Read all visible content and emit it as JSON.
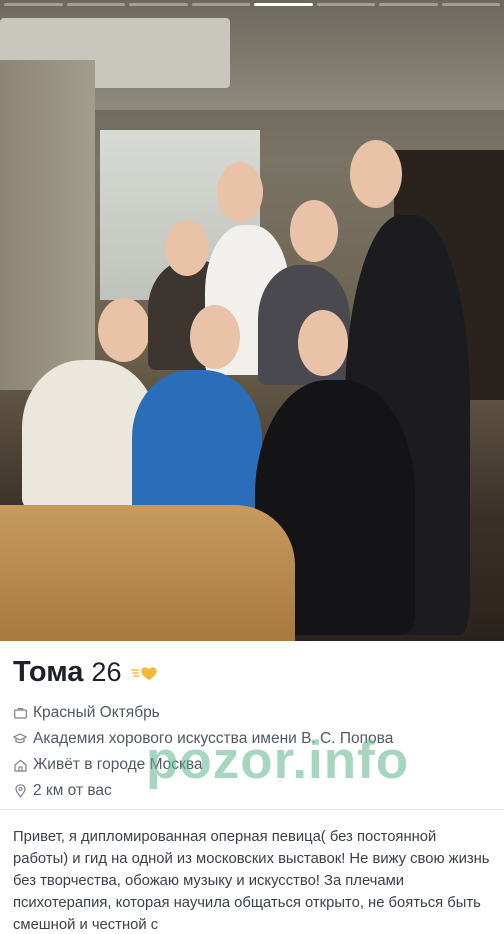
{
  "profile": {
    "name": "Тома",
    "age": "26",
    "work": "Красный Октябрь",
    "education": "Академия хорового искусства имени В. С. Попова",
    "city": "Живёт в городе Москва",
    "distance": "2 км от вас",
    "bio": "Привет, я дипломированная оперная певица( без постоянной работы) и гид на одной из московских выставок! Не вижу свою жизнь без творчества, обожаю музыку и искусство! За плечами психотерапия, которая научила общаться открыто, не бояться быть смешной и честной с"
  },
  "photo_progress": {
    "count": 8,
    "active_index": 4
  },
  "watermark": "pozor.info",
  "icons": {
    "verified": "wavy-heart-badge-icon",
    "work": "briefcase-icon",
    "education": "graduation-cap-icon",
    "city": "home-icon",
    "distance": "location-pin-icon"
  },
  "colors": {
    "badge": "#f5b83d",
    "watermark": "#5fb48c"
  }
}
